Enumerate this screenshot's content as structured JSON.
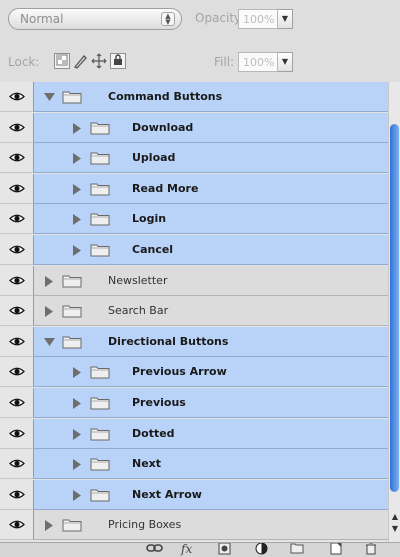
{
  "options": {
    "blend_mode": "Normal",
    "opacity_label": "Opacity:",
    "opacity_value": "100%",
    "lock_label": "Lock:",
    "fill_label": "Fill:",
    "fill_value": "100%"
  },
  "layers": [
    {
      "name": "Command Buttons",
      "selected": true,
      "expanded": true,
      "indent": 0
    },
    {
      "name": "Download",
      "selected": true,
      "expanded": false,
      "indent": 1
    },
    {
      "name": "Upload",
      "selected": true,
      "expanded": false,
      "indent": 1
    },
    {
      "name": "Read More",
      "selected": true,
      "expanded": false,
      "indent": 1
    },
    {
      "name": "Login",
      "selected": true,
      "expanded": false,
      "indent": 1
    },
    {
      "name": "Cancel",
      "selected": true,
      "expanded": false,
      "indent": 1
    },
    {
      "name": "Newsletter",
      "selected": false,
      "expanded": false,
      "indent": 0
    },
    {
      "name": "Search Bar",
      "selected": false,
      "expanded": false,
      "indent": 0
    },
    {
      "name": "Directional Buttons",
      "selected": true,
      "expanded": true,
      "indent": 0
    },
    {
      "name": "Previous Arrow",
      "selected": true,
      "expanded": false,
      "indent": 1
    },
    {
      "name": "Previous",
      "selected": true,
      "expanded": false,
      "indent": 1
    },
    {
      "name": "Dotted",
      "selected": true,
      "expanded": false,
      "indent": 1
    },
    {
      "name": "Next",
      "selected": true,
      "expanded": false,
      "indent": 1
    },
    {
      "name": "Next Arrow",
      "selected": true,
      "expanded": false,
      "indent": 1
    },
    {
      "name": "Pricing Boxes",
      "selected": false,
      "expanded": false,
      "indent": 0
    }
  ],
  "colors": {
    "selected_row": "#b8d3f7",
    "unselected_row": "#dcdcdc",
    "scroll_thumb": "#3a7bdc"
  },
  "icons": {
    "visibility": "eye-icon",
    "group": "folder-icon",
    "disclosure": "triangle-icon",
    "bottom_toolbar": [
      "link-layers-icon",
      "fx-icon",
      "layer-mask-icon",
      "adjustment-layer-icon",
      "new-group-icon",
      "new-layer-icon",
      "trash-icon"
    ]
  }
}
